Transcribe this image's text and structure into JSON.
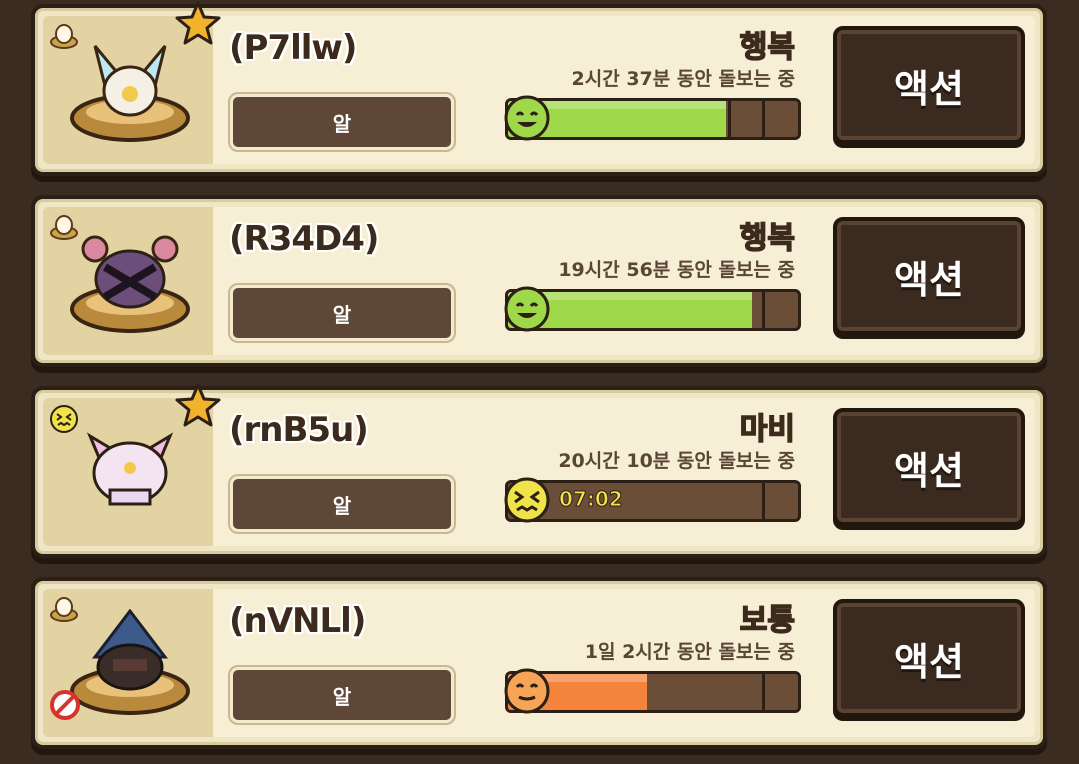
{
  "pets": [
    {
      "name": "(P7llw)",
      "stage": "알",
      "mood": "행복",
      "mood_color": "#9bd94a",
      "care_time": "2시간 37분 동안 돌보는 중",
      "fill_percent": 75,
      "bar_color": "#9fd94a",
      "face": "happy-face-icon",
      "starred": true,
      "status_icon": "egg-icon",
      "timer": "",
      "action_label": "액션",
      "art_color": "#aee3f0"
    },
    {
      "name": "(R34D4)",
      "stage": "알",
      "mood": "행복",
      "mood_color": "#9bd94a",
      "care_time": "19시간 56분 동안 돌보는 중",
      "fill_percent": 84,
      "bar_color": "#9fd94a",
      "face": "happy-face-icon",
      "starred": false,
      "status_icon": "egg-icon",
      "timer": "",
      "action_label": "액션",
      "art_color": "#6b4f7a"
    },
    {
      "name": "(rnB5u)",
      "stage": "알",
      "mood": "마비",
      "mood_color": "#f0e34a",
      "care_time": "20시간 10분 동안 돌보는 중",
      "fill_percent": 0,
      "bar_color": "#f0e34a",
      "face": "paralyzed-face-icon",
      "starred": true,
      "status_icon": "paralyzed-face-icon",
      "timer": "07:02",
      "action_label": "액션",
      "art_color": "#f4e4f2"
    },
    {
      "name": "(nVNLl)",
      "stage": "알",
      "mood": "보통",
      "mood_color": "#f07a3a",
      "care_time": "1일 2시간 동안 돌보는 중",
      "fill_percent": 48,
      "bar_color": "#f4843c",
      "face": "neutral-face-icon",
      "starred": false,
      "status_icon": "egg-icon",
      "timer": "",
      "action_label": "액션",
      "art_color": "#3c5a8a"
    }
  ]
}
